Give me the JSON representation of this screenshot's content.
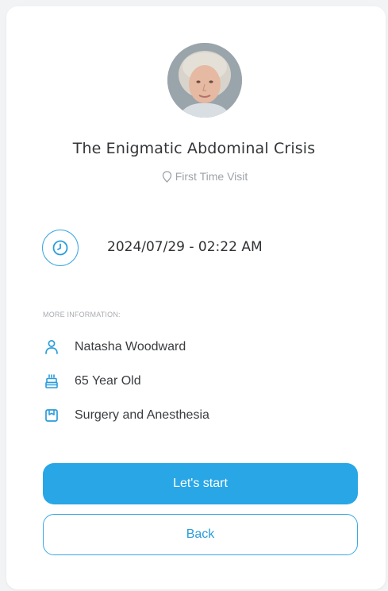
{
  "case": {
    "title": "The Enigmatic Abdominal Crisis",
    "visit_type": "First Time Visit"
  },
  "schedule": {
    "datetime": "2024/07/29 - 02:22 AM"
  },
  "more_info": {
    "label": "MORE INFORMATION:",
    "items": [
      {
        "icon": "person-icon",
        "text": "Natasha Woodward"
      },
      {
        "icon": "birthday-cake-icon",
        "text": "65 Year Old"
      },
      {
        "icon": "bookmark-icon",
        "text": "Surgery and Anesthesia"
      }
    ]
  },
  "actions": {
    "start_label": "Let's start",
    "back_label": "Back"
  },
  "colors": {
    "accent": "#28a6e6",
    "accent_border": "#3aa8e4",
    "muted": "#9ea3a8",
    "background": "#f2f3f5"
  }
}
